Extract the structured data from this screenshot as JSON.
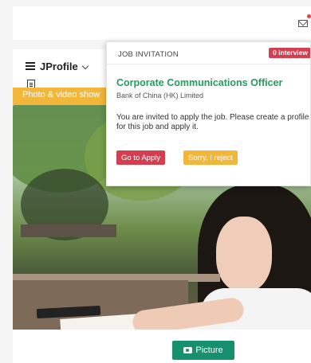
{
  "header": {
    "mail_icon": "mail-icon"
  },
  "profile": {
    "title": "JProfile",
    "doc_icon": "document-icon",
    "banner": "Photo & video show",
    "picture_button": "Picture",
    "picture_icon": "camera-icon"
  },
  "popup": {
    "heading": "JOB INVITATION",
    "badge": "0 interview",
    "job_title": "Corporate Communications Officer",
    "company": "Bank of China (HK) Limited",
    "message": "You are invited to apply the job. Please create a profile for this job and apply it.",
    "apply_label": "Go to Apply",
    "reject_label": "Sorry, I reject"
  },
  "colors": {
    "accent_green": "#16906e",
    "title_green": "#21a05b",
    "apply_red": "#d43f50",
    "banner_yellow": "#f2b63a"
  }
}
